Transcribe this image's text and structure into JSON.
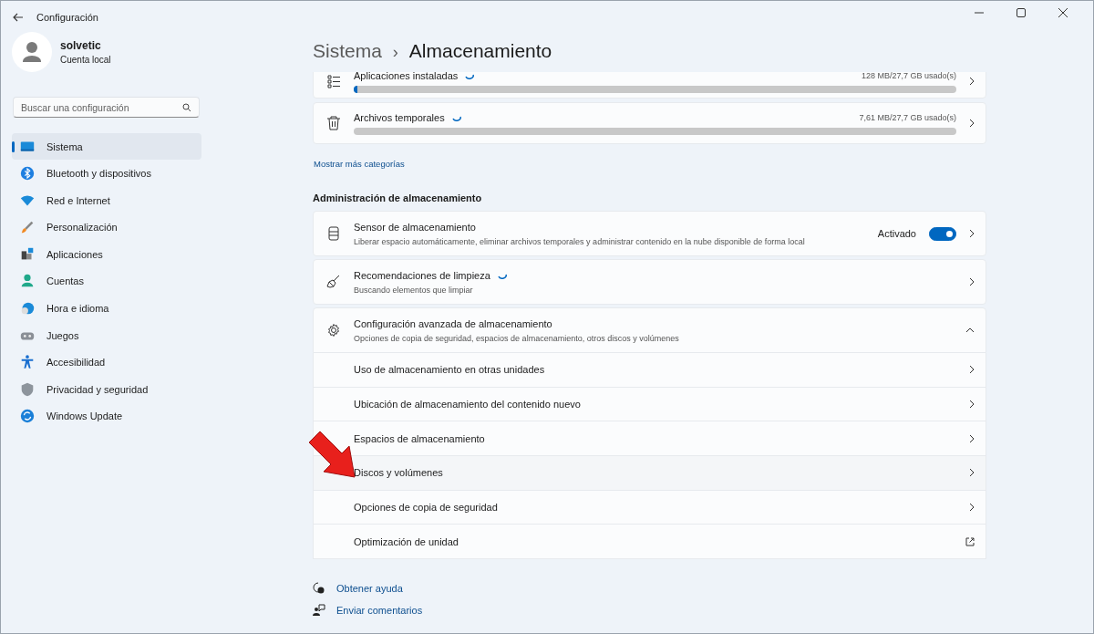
{
  "window": {
    "title": "Configuración"
  },
  "account": {
    "name": "solvetic",
    "type": "Cuenta local"
  },
  "search": {
    "placeholder": "Buscar una configuración"
  },
  "sidebar": {
    "items": [
      {
        "label": "Sistema",
        "selected": true
      },
      {
        "label": "Bluetooth y dispositivos",
        "selected": false
      },
      {
        "label": "Red e Internet",
        "selected": false
      },
      {
        "label": "Personalización",
        "selected": false
      },
      {
        "label": "Aplicaciones",
        "selected": false
      },
      {
        "label": "Cuentas",
        "selected": false
      },
      {
        "label": "Hora e idioma",
        "selected": false
      },
      {
        "label": "Juegos",
        "selected": false
      },
      {
        "label": "Accesibilidad",
        "selected": false
      },
      {
        "label": "Privacidad y seguridad",
        "selected": false
      },
      {
        "label": "Windows Update",
        "selected": false
      }
    ]
  },
  "breadcrumb": {
    "parent": "Sistema",
    "separator": "›",
    "current": "Almacenamiento"
  },
  "categories": [
    {
      "label": "Aplicaciones instaladas",
      "usage": "128 MB/27,7 GB usado(s)",
      "level": 0.006,
      "loading": true
    },
    {
      "label": "Archivos temporales",
      "usage": "7,61 MB/27,7 GB usado(s)",
      "level": 0.0,
      "loading": true
    }
  ],
  "more_link": "Mostrar más categorías",
  "management": {
    "heading": "Administración de almacenamiento",
    "cards": [
      {
        "title": "Sensor de almacenamiento",
        "subtitle": "Liberar espacio automáticamente, eliminar archivos temporales y administrar contenido en la nube disponible de forma local",
        "toggle_label": "Activado",
        "on": true,
        "loading": false
      },
      {
        "title": "Recomendaciones de limpieza",
        "subtitle": "Buscando elementos que limpiar",
        "loading": true
      }
    ],
    "advanced": {
      "title": "Configuración avanzada de almacenamiento",
      "subtitle": "Opciones de copia de seguridad, espacios de almacenamiento, otros discos y volúmenes",
      "expanded": true,
      "items": [
        {
          "label": "Uso de almacenamiento en otras unidades",
          "kind": "nav",
          "hovered": false
        },
        {
          "label": "Ubicación de almacenamiento del contenido nuevo",
          "kind": "nav",
          "hovered": false
        },
        {
          "label": "Espacios de almacenamiento",
          "kind": "nav",
          "hovered": false
        },
        {
          "label": "Discos y volúmenes",
          "kind": "nav",
          "hovered": true
        },
        {
          "label": "Opciones de copia de seguridad",
          "kind": "nav",
          "hovered": false
        },
        {
          "label": "Optimización de unidad",
          "kind": "external",
          "hovered": false
        }
      ]
    }
  },
  "footer_links": [
    "Obtener ayuda",
    "Enviar comentarios"
  ]
}
